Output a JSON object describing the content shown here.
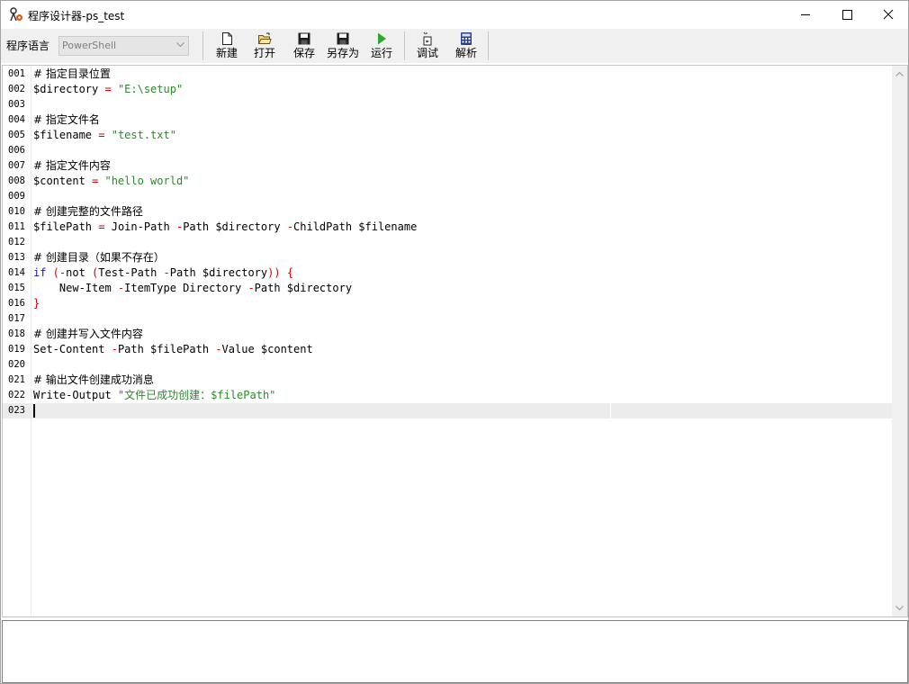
{
  "window": {
    "title": "程序设计器-ps_test",
    "minimize_icon": "minimize-icon",
    "maximize_icon": "maximize-icon",
    "close_icon": "close-icon"
  },
  "toolbar": {
    "language_label": "程序语言",
    "language_value": "PowerShell",
    "buttons": [
      {
        "label": "新建",
        "icon": "new-file-icon"
      },
      {
        "label": "打开",
        "icon": "open-folder-icon"
      },
      {
        "label": "保存",
        "icon": "save-icon"
      },
      {
        "label": "另存为",
        "icon": "save-as-icon"
      },
      {
        "label": "运行",
        "icon": "run-icon"
      },
      {
        "label": "调试",
        "icon": "debug-icon"
      },
      {
        "label": "解析",
        "icon": "calculator-icon"
      }
    ]
  },
  "editor": {
    "current_line": 23,
    "lines": [
      {
        "num": "001",
        "tokens": [
          {
            "t": "# 指定目录位置",
            "k": "comment"
          }
        ]
      },
      {
        "num": "002",
        "tokens": [
          {
            "t": "$directory",
            "k": "var"
          },
          {
            "t": " = ",
            "k": "op"
          },
          {
            "t": "\"E:\\setup\"",
            "k": "str"
          }
        ]
      },
      {
        "num": "003",
        "tokens": []
      },
      {
        "num": "004",
        "tokens": [
          {
            "t": "# 指定文件名",
            "k": "comment"
          }
        ]
      },
      {
        "num": "005",
        "tokens": [
          {
            "t": "$filename",
            "k": "var"
          },
          {
            "t": " = ",
            "k": "op"
          },
          {
            "t": "\"test.txt\"",
            "k": "str"
          }
        ]
      },
      {
        "num": "006",
        "tokens": []
      },
      {
        "num": "007",
        "tokens": [
          {
            "t": "# 指定文件内容",
            "k": "comment"
          }
        ]
      },
      {
        "num": "008",
        "tokens": [
          {
            "t": "$content",
            "k": "var"
          },
          {
            "t": " = ",
            "k": "op"
          },
          {
            "t": "\"hello world\"",
            "k": "str"
          }
        ]
      },
      {
        "num": "009",
        "tokens": []
      },
      {
        "num": "010",
        "tokens": [
          {
            "t": "# 创建完整的文件路径",
            "k": "comment"
          }
        ]
      },
      {
        "num": "011",
        "tokens": [
          {
            "t": "$filePath",
            "k": "var"
          },
          {
            "t": " = ",
            "k": "op"
          },
          {
            "t": "Join-Path ",
            "k": "cmd"
          },
          {
            "t": "-",
            "k": "op"
          },
          {
            "t": "Path $directory ",
            "k": "param"
          },
          {
            "t": "-",
            "k": "op"
          },
          {
            "t": "ChildPath $filename",
            "k": "param"
          }
        ]
      },
      {
        "num": "012",
        "tokens": []
      },
      {
        "num": "013",
        "tokens": [
          {
            "t": "# 创建目录（如果不存在）",
            "k": "comment"
          }
        ]
      },
      {
        "num": "014",
        "tokens": [
          {
            "t": "if",
            "k": "kw"
          },
          {
            "t": " (",
            "k": "punc"
          },
          {
            "t": "-",
            "k": "op"
          },
          {
            "t": "not ",
            "k": "cmd"
          },
          {
            "t": "(",
            "k": "punc"
          },
          {
            "t": "Test-Path ",
            "k": "cmd"
          },
          {
            "t": "-",
            "k": "op"
          },
          {
            "t": "Path $directory",
            "k": "param"
          },
          {
            "t": ")) {",
            "k": "punc"
          }
        ]
      },
      {
        "num": "015",
        "tokens": [
          {
            "t": "    New-Item ",
            "k": "cmd"
          },
          {
            "t": "-",
            "k": "op"
          },
          {
            "t": "ItemType Directory ",
            "k": "param"
          },
          {
            "t": "-",
            "k": "op"
          },
          {
            "t": "Path $directory",
            "k": "param"
          }
        ]
      },
      {
        "num": "016",
        "tokens": [
          {
            "t": "}",
            "k": "punc"
          }
        ]
      },
      {
        "num": "017",
        "tokens": []
      },
      {
        "num": "018",
        "tokens": [
          {
            "t": "# 创建并写入文件内容",
            "k": "comment"
          }
        ]
      },
      {
        "num": "019",
        "tokens": [
          {
            "t": "Set-Content ",
            "k": "cmd"
          },
          {
            "t": "-",
            "k": "op"
          },
          {
            "t": "Path $filePath ",
            "k": "param"
          },
          {
            "t": "-",
            "k": "op"
          },
          {
            "t": "Value $content",
            "k": "param"
          }
        ]
      },
      {
        "num": "020",
        "tokens": []
      },
      {
        "num": "021",
        "tokens": [
          {
            "t": "# 输出文件创建成功消息",
            "k": "comment"
          }
        ]
      },
      {
        "num": "022",
        "tokens": [
          {
            "t": "Write-Output ",
            "k": "cmd"
          },
          {
            "t": "\"文件已成功创建：$filePath\"",
            "k": "str"
          }
        ]
      },
      {
        "num": "023",
        "tokens": []
      }
    ]
  },
  "output": {
    "text": ""
  },
  "colors": {
    "comment": "#000000",
    "operator": "#d80000",
    "string": "#2a8a2a",
    "keyword": "#1a1aa0",
    "run_icon": "#2ea82e"
  }
}
